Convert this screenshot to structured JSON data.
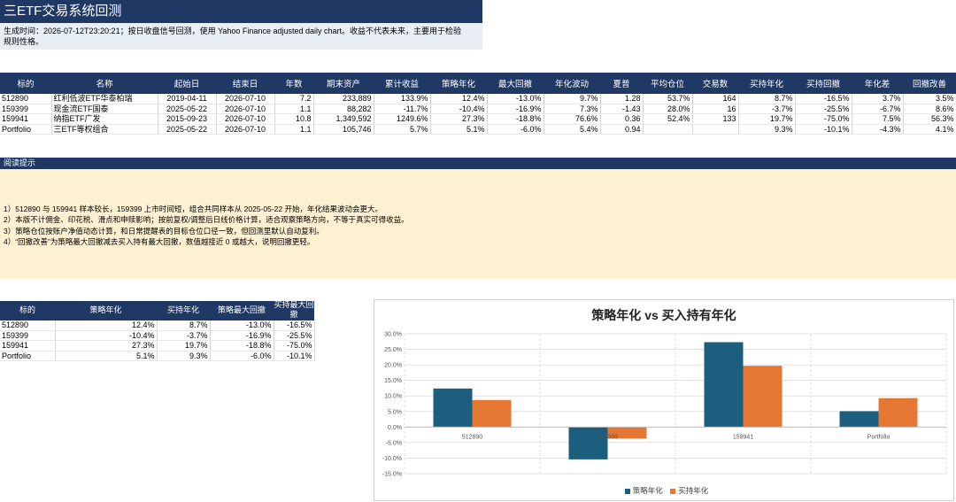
{
  "header": {
    "title": "三ETF交易系统回测",
    "subtitle_line1": "生成时间：2026-07-12T23:20:21；按日收盘信号回测，使用 Yahoo Finance adjusted daily chart。收益不代表未来，主要用于检验",
    "subtitle_line2": "规则性格。"
  },
  "main_table": {
    "headers": [
      "标的",
      "名称",
      "起始日",
      "结束日",
      "年数",
      "期末资产",
      "累计收益",
      "策略年化",
      "最大回撤",
      "年化波动",
      "夏普",
      "平均仓位",
      "交易数",
      "买持年化",
      "买持回撤",
      "年化差",
      "回撤改善"
    ],
    "rows": [
      [
        "512890",
        "红利低波ETF华泰柏瑞",
        "2019-04-11",
        "2026-07-10",
        "7.2",
        "233,889",
        "133.9%",
        "12.4%",
        "-13.0%",
        "9.7%",
        "1.28",
        "53.7%",
        "164",
        "8.7%",
        "-16.5%",
        "3.7%",
        "3.5%"
      ],
      [
        "159399",
        "现金流ETF国泰",
        "2025-05-22",
        "2026-07-10",
        "1.1",
        "88,282",
        "-11.7%",
        "-10.4%",
        "-16.9%",
        "7.3%",
        "-1.43",
        "28.0%",
        "16",
        "-3.7%",
        "-25.5%",
        "-6.7%",
        "8.6%"
      ],
      [
        "159941",
        "纳指ETF广发",
        "2015-09-23",
        "2026-07-10",
        "10.8",
        "1,349,592",
        "1249.6%",
        "27.3%",
        "-18.8%",
        "76.6%",
        "0.36",
        "52.4%",
        "133",
        "19.7%",
        "-75.0%",
        "7.5%",
        "56.3%"
      ],
      [
        "Portfolio",
        "三ETF等权组合",
        "2025-05-22",
        "2026-07-10",
        "1.1",
        "105,746",
        "5.7%",
        "5.1%",
        "-6.0%",
        "5.4%",
        "0.94",
        "",
        "",
        "9.3%",
        "-10.1%",
        "-4.3%",
        "4.1%"
      ]
    ]
  },
  "notes": {
    "title": "阅读提示",
    "lines": [
      "1）512890 与 159941 样本较长，159399 上市时间短，组合共同样本从 2025-05-22 开始，年化结果波动会更大。",
      "2）本版不计佣金、印花税、滑点和申赎影响；按前复权/调整后日线价格计算，适合观察策略方向，不等于真实可得收益。",
      "3）策略仓位按账户净值动态计算，和日常提醒表的目标仓位口径一致，但回测里默认自动复利。",
      "4）“回撤改善”为策略最大回撤减去买入持有最大回撤，数值越接近 0 或越大，说明回撤更轻。"
    ]
  },
  "small_table": {
    "headers": [
      "标的",
      "策略年化",
      "买持年化",
      "策略最大回撤",
      "买持最大回撤"
    ],
    "rows": [
      [
        "512890",
        "12.4%",
        "8.7%",
        "-13.0%",
        "-16.5%"
      ],
      [
        "159399",
        "-10.4%",
        "-3.7%",
        "-16.9%",
        "-25.5%"
      ],
      [
        "159941",
        "27.3%",
        "19.7%",
        "-18.8%",
        "-75.0%"
      ],
      [
        "Portfolio",
        "5.1%",
        "9.3%",
        "-6.0%",
        "-10.1%"
      ]
    ]
  },
  "colors": {
    "header_bg": "#1f3864",
    "series1": "#1b5e7e",
    "series2": "#e67733",
    "notes_bg": "#fdf1d2"
  },
  "chart_data": {
    "type": "bar",
    "title": "策略年化 vs 买入持有年化",
    "categories": [
      "512890",
      "159399",
      "159941",
      "Portfolio"
    ],
    "series": [
      {
        "name": "策略年化",
        "values": [
          12.4,
          -10.4,
          27.3,
          5.1
        ]
      },
      {
        "name": "买持年化",
        "values": [
          8.7,
          -3.7,
          19.7,
          9.3
        ]
      }
    ],
    "ylim": [
      -15,
      30
    ],
    "yticks": [
      "-15.0%",
      "-10.0%",
      "-5.0%",
      "0.0%",
      "5.0%",
      "10.0%",
      "15.0%",
      "20.0%",
      "25.0%",
      "30.0%"
    ],
    "grid": true,
    "legend": "bottom"
  }
}
